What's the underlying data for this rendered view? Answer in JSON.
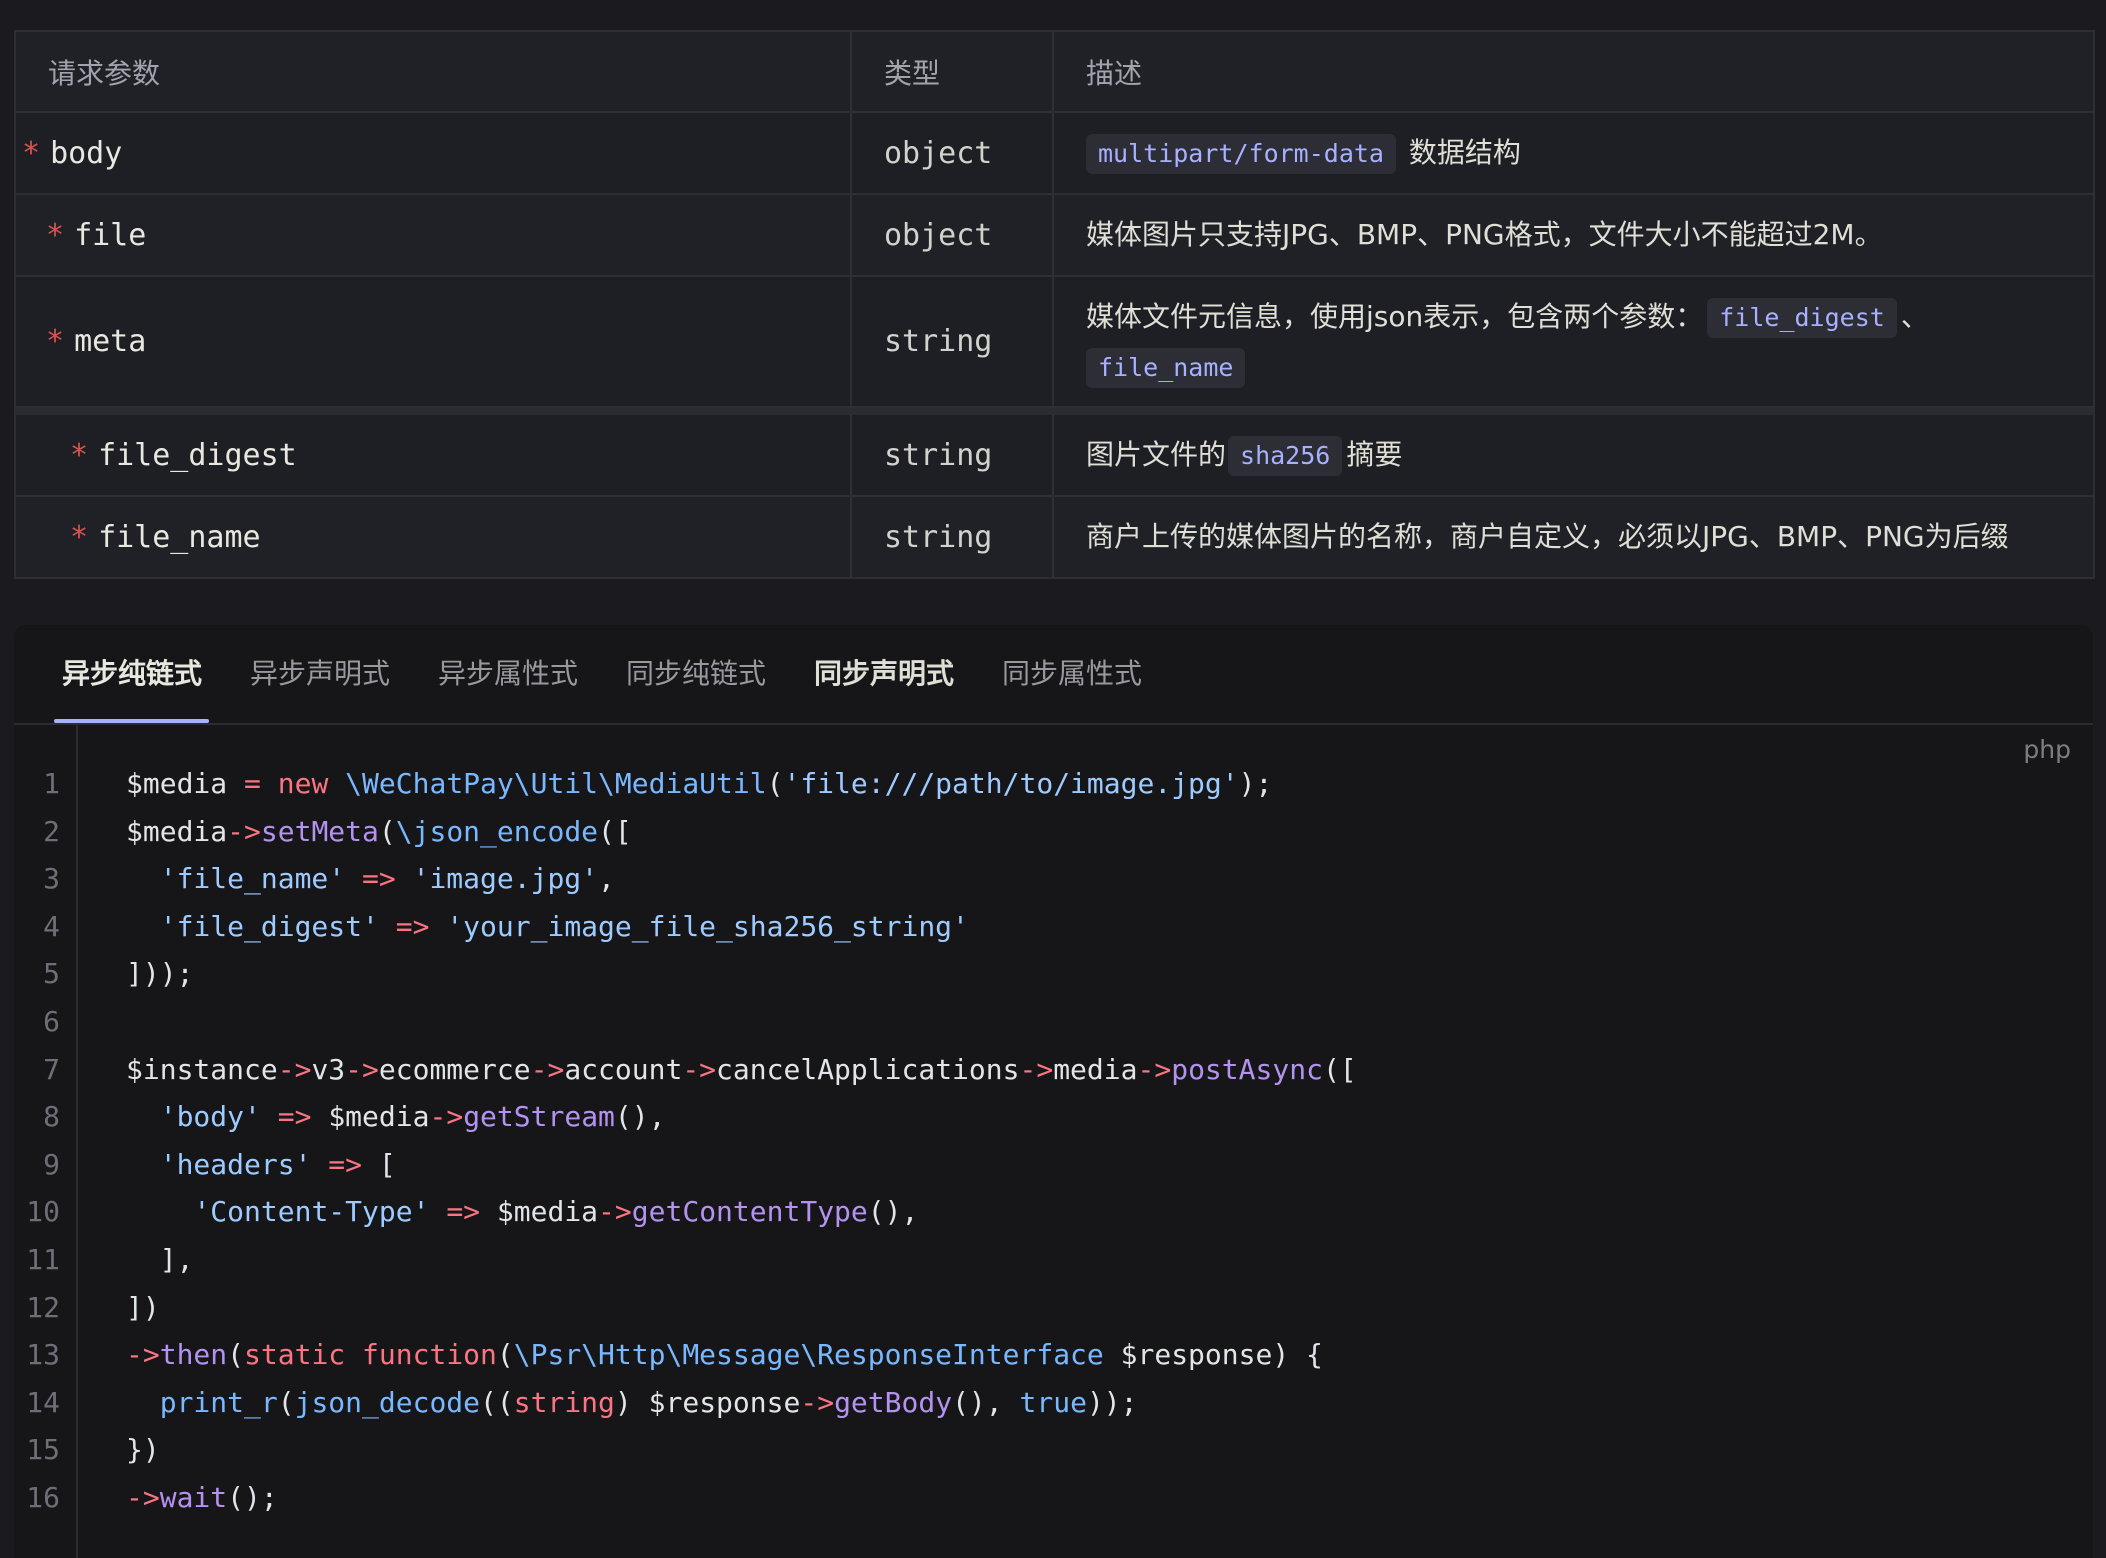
{
  "table": {
    "headers": [
      "请求参数",
      "类型",
      "描述"
    ],
    "rows": [
      {
        "name": "body",
        "type": "object",
        "desc_code": "multipart/form-data",
        "desc_text": "数据结构"
      },
      {
        "name": "file",
        "type": "object",
        "desc_text": "媒体图片只支持JPG、BMP、PNG格式，文件大小不能超过2M。"
      },
      {
        "name": "meta",
        "type": "string",
        "desc_text": "媒体文件元信息，使用json表示，包含两个参数：",
        "desc_code1": "file_digest",
        "desc_sep": "、",
        "desc_code2": "file_name"
      },
      {
        "name": "file_digest",
        "type": "string",
        "desc_pre": "图片文件的",
        "desc_code": "sha256",
        "desc_post": "摘要"
      },
      {
        "name": "file_name",
        "type": "string",
        "desc_text": "商户上传的媒体图片的名称，商户自定义，必须以JPG、BMP、PNG为后缀"
      }
    ],
    "required_mark": "*"
  },
  "tabs": [
    "异步纯链式",
    "异步声明式",
    "异步属性式",
    "同步纯链式",
    "同步声明式",
    "同步属性式"
  ],
  "active_tab": "异步纯链式",
  "code": {
    "language": "php",
    "line_numbers": [
      "1",
      "2",
      "3",
      "4",
      "5",
      "6",
      "7",
      "8",
      "9",
      "10",
      "11",
      "12",
      "13",
      "14",
      "15",
      "16"
    ],
    "lines": [
      "$media = new \\WeChatPay\\Util\\MediaUtil('file:///path/to/image.jpg');",
      "$media->setMeta(\\json_encode([",
      "  'file_name' => 'image.jpg',",
      "  'file_digest' => 'your_image_file_sha256_string'",
      "]));",
      "",
      "$instance->v3->ecommerce->account->cancelApplications->media->postAsync([",
      "  'body' => $media->getStream(),",
      "  'headers' => [",
      "    'Content-Type' => $media->getContentType(),",
      "  ],",
      "])",
      "->then(static function(\\Psr\\Http\\Message\\ResponseInterface $response) {",
      "  print_r(json_decode((string) $response->getBody(), true));",
      "})",
      "->wait();"
    ]
  }
}
